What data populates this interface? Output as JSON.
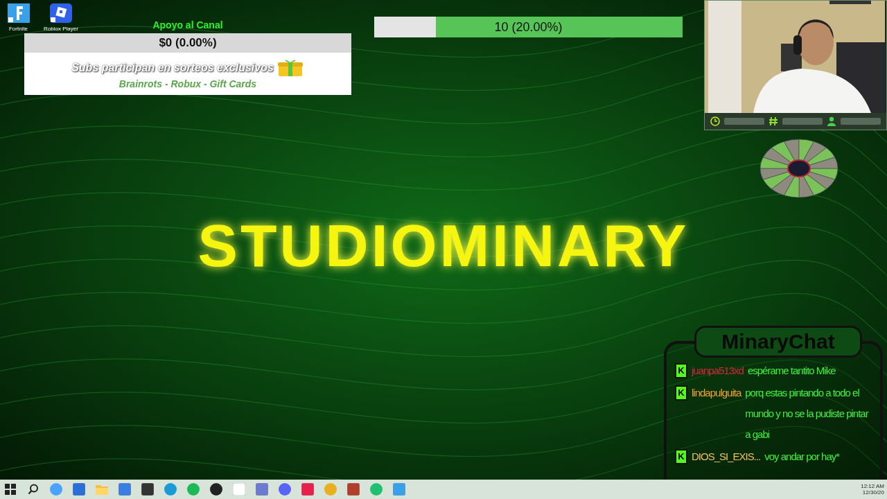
{
  "desktop_icons": [
    {
      "label": "Fortnite",
      "kind": "fortnite"
    },
    {
      "label": "Roblox Player",
      "kind": "roblox"
    }
  ],
  "donation_goal": {
    "title": "Apoyo al Canal",
    "reading": "$0 (0.00%)",
    "banner": "Subs participan en sorteos exclusivos",
    "prizes": "Brainrots - Robux - Gift Cards"
  },
  "follower_goal": {
    "level": 0.2,
    "reading": "10 (20.00%)"
  },
  "stream_title": "STUDIOMINARY",
  "chat": {
    "title": "MinaryChat",
    "messages": [
      {
        "badge": "K",
        "user": "juanpa513xd",
        "color": "#d8243c",
        "text": "espérame tantito Mike"
      },
      {
        "badge": "K",
        "user": "lindapulguita",
        "color": "#f0a030",
        "text": "porq estas pintando a todo el mundo y no se la pudiste pintar a gabi"
      },
      {
        "badge": "K",
        "user": "DIOS_SI_EXIS...",
        "color": "#f0c060",
        "text": "voy andar por hay*"
      }
    ]
  },
  "taskbar": {
    "time": "12:12 AM",
    "date": "12/30/20"
  }
}
